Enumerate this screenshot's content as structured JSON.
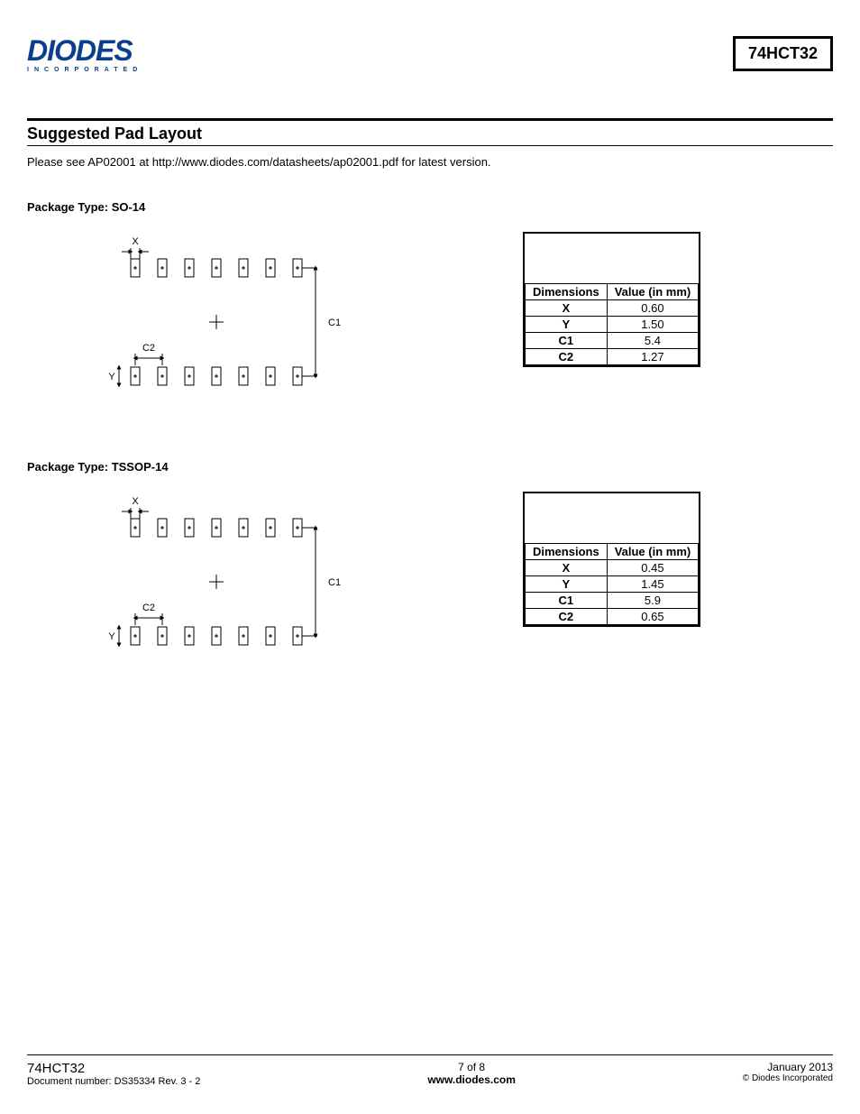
{
  "header": {
    "logo_top": "DIODES",
    "logo_sub": "INCORPORATED",
    "part_number": "74HCT32"
  },
  "section": {
    "title": "Suggested Pad Layout",
    "intro": "Please see AP02001 at http://www.diodes.com/datasheets/ap02001.pdf for latest version."
  },
  "packages": [
    {
      "label": "Package Type: SO-14",
      "diagram": {
        "x": "X",
        "y": "Y",
        "c1": "C1",
        "c2": "C2"
      },
      "table": {
        "head_dim": "Dimensions",
        "head_val": "Value (in mm)",
        "rows": [
          {
            "k": "X",
            "v": "0.60"
          },
          {
            "k": "Y",
            "v": "1.50"
          },
          {
            "k": "C1",
            "v": "5.4"
          },
          {
            "k": "C2",
            "v": "1.27"
          }
        ]
      }
    },
    {
      "label": "Package Type: TSSOP-14",
      "diagram": {
        "x": "X",
        "y": "Y",
        "c1": "C1",
        "c2": "C2"
      },
      "table": {
        "head_dim": "Dimensions",
        "head_val": "Value (in mm)",
        "rows": [
          {
            "k": "X",
            "v": "0.45"
          },
          {
            "k": "Y",
            "v": "1.45"
          },
          {
            "k": "C1",
            "v": "5.9"
          },
          {
            "k": "C2",
            "v": "0.65"
          }
        ]
      }
    }
  ],
  "footer": {
    "part_number": "74HCT32",
    "doc": "Document number: DS35334  Rev. 3 - 2",
    "page": "7 of 8",
    "url": "www.diodes.com",
    "date": "January 2013",
    "copyright": "© Diodes Incorporated"
  }
}
